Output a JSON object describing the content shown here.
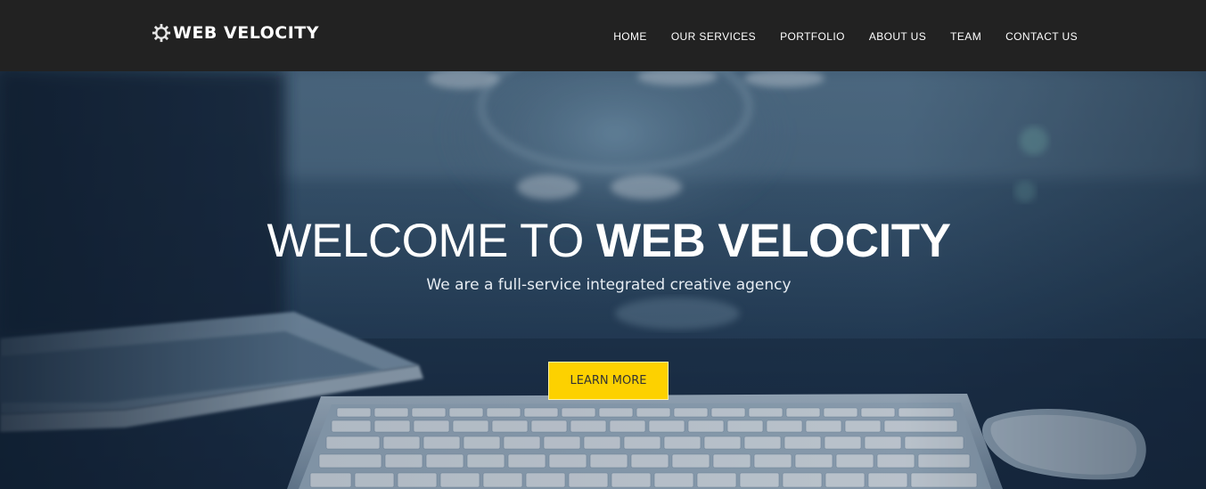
{
  "brand": {
    "name": "WEB VELOCITY",
    "icon": "gear-icon"
  },
  "nav": {
    "items": [
      {
        "label": "HOME"
      },
      {
        "label": "OUR SERVICES"
      },
      {
        "label": "PORTFOLIO"
      },
      {
        "label": "ABOUT US"
      },
      {
        "label": "TEAM"
      },
      {
        "label": "CONTACT US"
      }
    ]
  },
  "hero": {
    "title_light": "WELCOME TO",
    "title_bold": "WEB VELOCITY",
    "subtitle": "We are a full-service integrated creative agency",
    "cta_label": "LEARN MORE"
  },
  "colors": {
    "navbar": "#222222",
    "cta": "#fdd100",
    "hero_tint": "#2d4862"
  }
}
